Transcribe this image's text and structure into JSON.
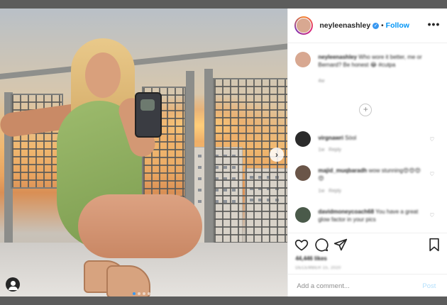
{
  "post": {
    "username": "neyleenashley",
    "verified_mark": "✓",
    "separator": "•",
    "follow_label": "Follow",
    "more_label": "•••",
    "next_label": "›"
  },
  "caption": {
    "username": "neyleenashley",
    "text": "Who wore it better, me or Bernard? Be honest 😂 #cutpa",
    "time": "4w"
  },
  "comments": [
    {
      "username": "virgnawri",
      "text": "Sòol",
      "time": "1w",
      "reply": "Reply"
    },
    {
      "username": "majid_muqbaradh",
      "text": "wow stunning😍😍😍😍",
      "time": "1w",
      "reply": "Reply"
    },
    {
      "username": "davidmoneycoach68",
      "text": "You have a great glow factor in your pics",
      "time": "",
      "reply": ""
    }
  ],
  "likes": "44,446 likes",
  "date": "DECEMBER 15, 2020",
  "add_comment_placeholder": "Add a comment...",
  "post_button": "Post",
  "plus_label": "+",
  "icons": {
    "heart": "heart-icon",
    "comment": "comment-icon",
    "share": "paper-plane-icon",
    "save": "bookmark-icon"
  },
  "colors": {
    "accent": "#0095f6",
    "verified": "#3897f0",
    "post_disabled": "#b2dffc"
  }
}
